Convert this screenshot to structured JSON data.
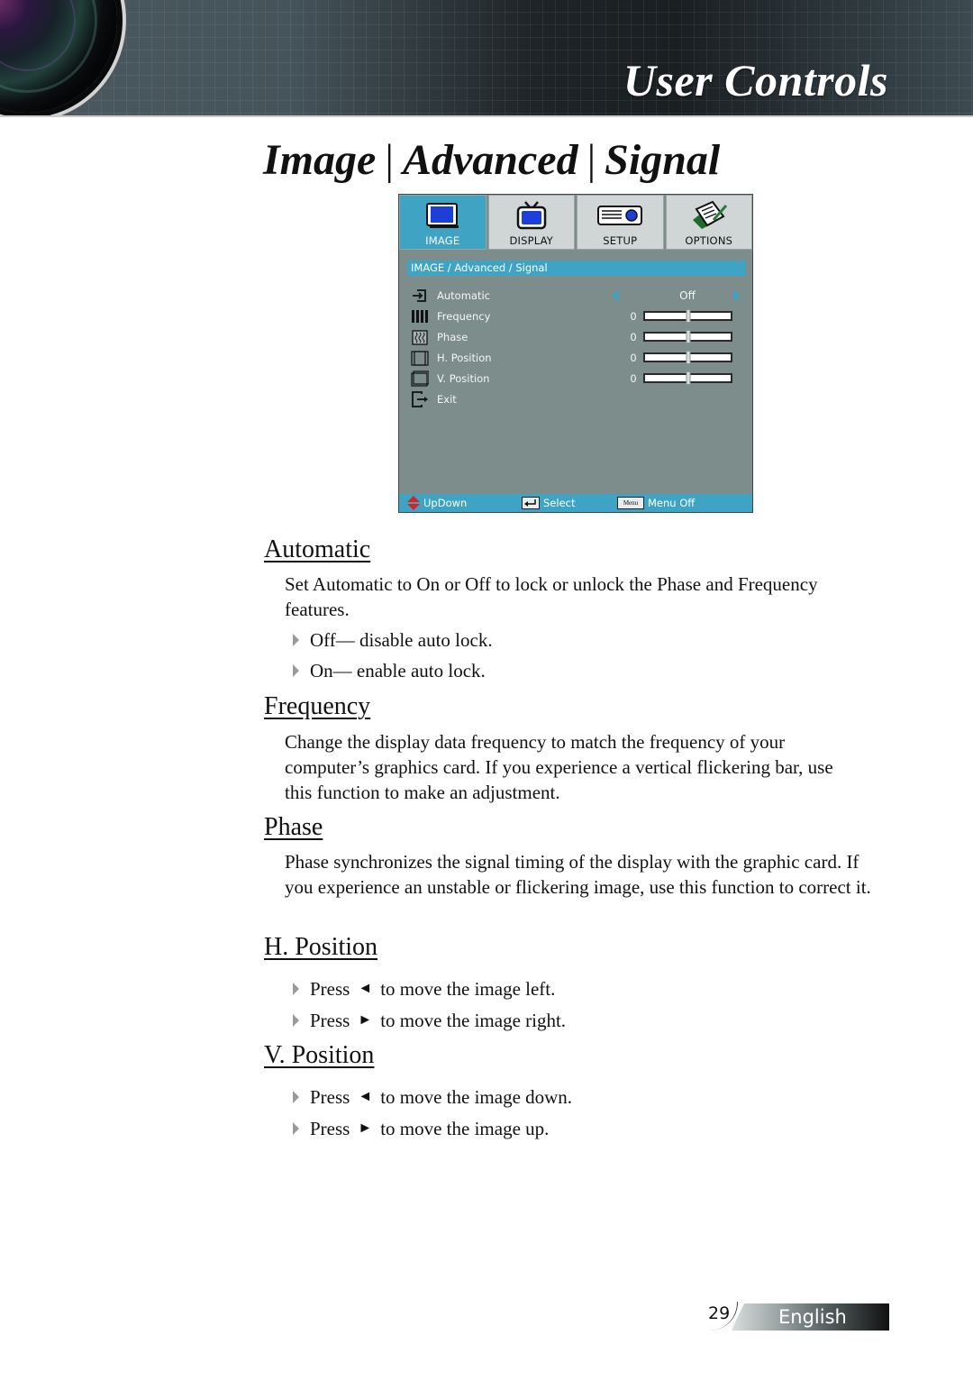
{
  "header": {
    "banner_title": "User Controls",
    "page_title_parts": [
      "Image",
      "Advanced",
      "Signal"
    ],
    "separator": "|"
  },
  "osd": {
    "tabs": [
      {
        "label": "IMAGE",
        "icon": "monitor-icon",
        "active": true
      },
      {
        "label": "DISPLAY",
        "icon": "tv-icon",
        "active": false
      },
      {
        "label": "SETUP",
        "icon": "projector-icon",
        "active": false
      },
      {
        "label": "OPTIONS",
        "icon": "notepad-pen-icon",
        "active": false
      }
    ],
    "breadcrumb": "IMAGE / Advanced / Signal",
    "rows": [
      {
        "label": "Automatic",
        "icon": "auto-input-icon",
        "type": "choice",
        "value": "Off"
      },
      {
        "label": "Frequency",
        "icon": "frequency-bars-icon",
        "type": "slider",
        "value": "0",
        "fraction": 0.5
      },
      {
        "label": "Phase",
        "icon": "phase-wave-icon",
        "type": "slider",
        "value": "0",
        "fraction": 0.5
      },
      {
        "label": "H. Position",
        "icon": "h-position-icon",
        "type": "slider",
        "value": "0",
        "fraction": 0.5
      },
      {
        "label": "V. Position",
        "icon": "v-position-icon",
        "type": "slider",
        "value": "0",
        "fraction": 0.5
      },
      {
        "label": "Exit",
        "icon": "exit-icon",
        "type": "action"
      }
    ],
    "footer": {
      "updown": "UpDown",
      "select": "Select",
      "menu_key": "Menu",
      "menu_off": "Menu Off"
    },
    "colors": {
      "accent": "#3fa3c4",
      "panel": "#7c8d8b",
      "tab": "#cfd6d5"
    }
  },
  "sections": {
    "automatic": {
      "heading": "Automatic",
      "paragraph": "Set Automatic to On or Off to lock or unlock the Phase and Frequency features.",
      "bullets": [
        "Off— disable auto lock.",
        "On— enable auto lock."
      ]
    },
    "frequency": {
      "heading": "Frequency",
      "paragraph": "Change the display data frequency to match the frequency of your computer’s graphics card. If you experience a vertical flickering bar, use this function to make an adjustment."
    },
    "phase": {
      "heading": "Phase",
      "paragraph": "Phase synchronizes the signal timing of the display with the graphic card. If you experience an unstable or flickering image, use this function to correct it."
    },
    "h_position": {
      "heading": "H. Position",
      "bullets": [
        {
          "pre": "Press",
          "arrow": "◄",
          "post": "to move the image left."
        },
        {
          "pre": "Press",
          "arrow": "►",
          "post": "to move the image right."
        }
      ]
    },
    "v_position": {
      "heading": "V. Position",
      "bullets": [
        {
          "pre": "Press",
          "arrow": "◄",
          "post": "to move the image down."
        },
        {
          "pre": "Press",
          "arrow": "►",
          "post": "to move the image up."
        }
      ]
    }
  },
  "footer": {
    "page_number": "29",
    "language": "English"
  }
}
